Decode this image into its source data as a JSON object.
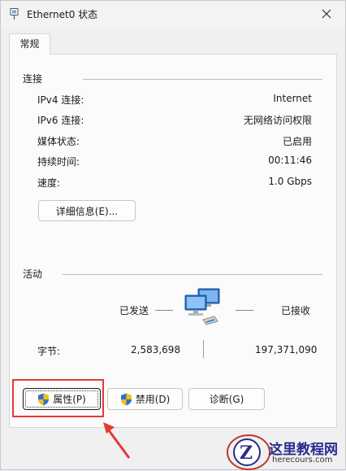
{
  "window": {
    "title": "Ethernet0 状态",
    "close_symbol": "✕"
  },
  "tabs": [
    {
      "label": "常规",
      "selected": true
    }
  ],
  "connection": {
    "group_title": "连接",
    "rows": [
      {
        "label": "IPv4 连接:",
        "value": "Internet"
      },
      {
        "label": "IPv6 连接:",
        "value": "无网络访问权限"
      },
      {
        "label": "媒体状态:",
        "value": "已启用"
      },
      {
        "label": "持续时间:",
        "value": "00:11:46"
      },
      {
        "label": "速度:",
        "value": "1.0 Gbps"
      }
    ],
    "details_button": "详细信息(E)..."
  },
  "activity": {
    "group_title": "活动",
    "sent_label": "已发送",
    "received_label": "已接收",
    "bytes_label": "字节:",
    "bytes_sent": "2,583,698",
    "bytes_received": "197,371,090",
    "icon": "network-computers-icon"
  },
  "buttons": {
    "properties": "属性(P)",
    "disable": "禁用(D)",
    "diagnose": "诊断(G)"
  },
  "watermark": {
    "title": "这里教程网",
    "url": "herecours.com"
  },
  "colors": {
    "highlight_box": "#e53935",
    "arrow": "#e53935",
    "watermark_text": "#2a2a8f"
  }
}
